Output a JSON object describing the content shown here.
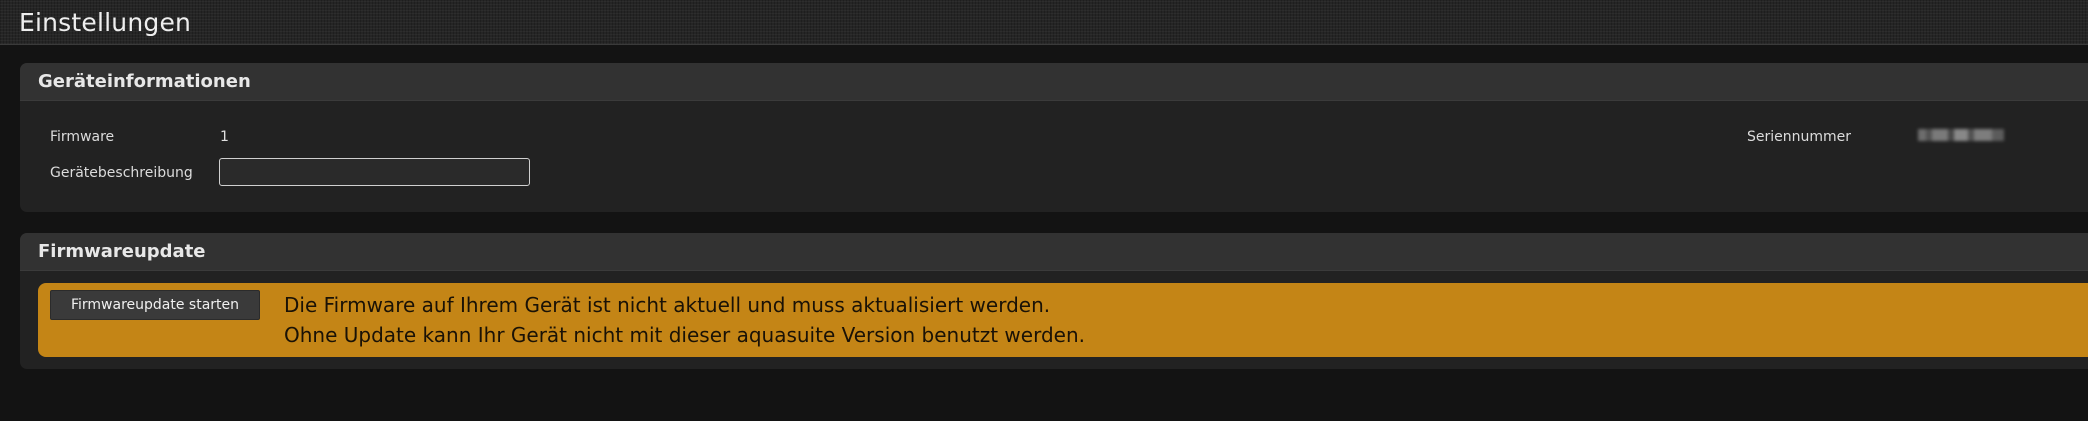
{
  "header": {
    "title": "Einstellungen"
  },
  "device_info": {
    "title": "Geräteinformationen",
    "firmware_label": "Firmware",
    "firmware_value": "1",
    "description_label": "Gerätebeschreibung",
    "description_value": "",
    "serial_label": "Seriennummer"
  },
  "firmware_update": {
    "title": "Firmwareupdate",
    "button_label": "Firmwareupdate starten",
    "warning_line_1": "Die Firmware auf Ihrem Gerät ist nicht aktuell und muss aktualisiert werden.",
    "warning_line_2": "Ohne Update kann Ihr Gerät nicht mit dieser aquasuite Version benutzt werden.",
    "warning_color": "#c48516"
  },
  "colors": {
    "background": "#131313",
    "panel": "#222222",
    "panel_header": "#323232",
    "button": "#3a3a3a"
  }
}
